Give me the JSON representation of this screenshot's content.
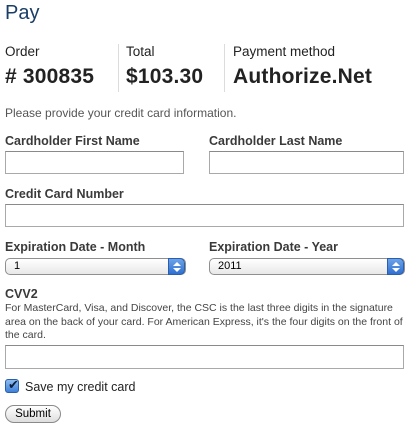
{
  "page": {
    "title": "Pay"
  },
  "summary": {
    "order_label": "Order",
    "order_value": "# 300835",
    "total_label": "Total",
    "total_value": "$103.30",
    "method_label": "Payment method",
    "method_value": "Authorize.Net"
  },
  "form": {
    "intro": "Please provide your credit card information.",
    "first_name": {
      "label": "Cardholder First Name",
      "value": ""
    },
    "last_name": {
      "label": "Cardholder Last Name",
      "value": ""
    },
    "card_number": {
      "label": "Credit Card Number",
      "value": ""
    },
    "exp_month": {
      "label": "Expiration Date - Month",
      "selected": "1"
    },
    "exp_year": {
      "label": "Expiration Date - Year",
      "selected": "2011"
    },
    "cvv": {
      "label": "CVV2",
      "help": "For MasterCard, Visa, and Discover, the CSC is the last three digits in the signature area on the back of your card. For American Express, it's the four digits on the front of the card.",
      "value": ""
    },
    "save_card": {
      "label": "Save my credit card",
      "checked": true
    },
    "submit_label": "Submit"
  },
  "colors": {
    "title": "#1a3e66",
    "accent": "#3f80d8"
  }
}
